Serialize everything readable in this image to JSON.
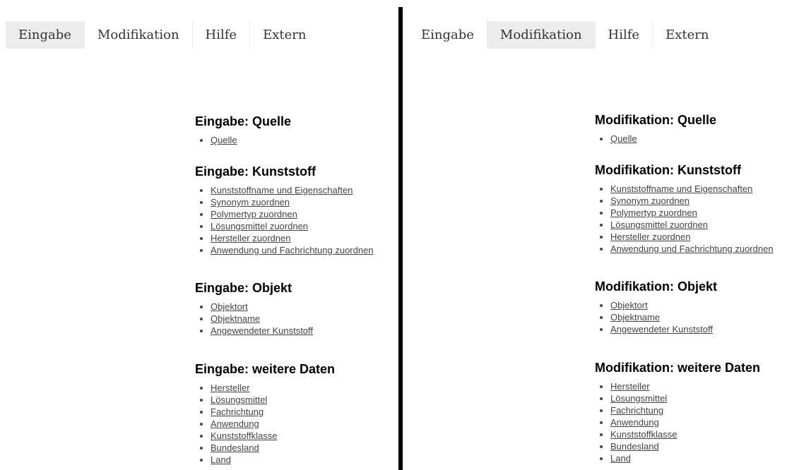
{
  "left": {
    "tabs": [
      "Eingabe",
      "Modifikation",
      "Hilfe",
      "Extern"
    ],
    "active_tab": 0,
    "sections": [
      {
        "title": "Eingabe: Quelle",
        "links": [
          "Quelle"
        ]
      },
      {
        "title": "Eingabe: Kunststoff",
        "links": [
          "Kunststoffname und Eigenschaften",
          "Synonym zuordnen",
          "Polymertyp zuordnen",
          "Lösungsmittel zuordnen",
          "Hersteller zuordnen",
          "Anwendung und Fachrichtung zuordnen"
        ]
      },
      {
        "title": "Eingabe: Objekt",
        "links": [
          "Objektort",
          "Objektname",
          "Angewendeter Kunststoff"
        ]
      },
      {
        "title": "Eingabe: weitere Daten",
        "links": [
          "Hersteller",
          "Lösungsmittel",
          "Fachrichtung",
          "Anwendung",
          "Kunststoffklasse",
          "Bundesland",
          "Land"
        ]
      }
    ]
  },
  "right": {
    "tabs": [
      "Eingabe",
      "Modifikation",
      "Hilfe",
      "Extern"
    ],
    "active_tab": 1,
    "sections": [
      {
        "title": "Modifikation: Quelle",
        "links": [
          "Quelle"
        ]
      },
      {
        "title": "Modifikation: Kunststoff",
        "links": [
          "Kunststoffname und Eigenschaften",
          "Synonym zuordnen",
          "Polymertyp zuordnen",
          "Lösungsmittel zuordnen",
          "Hersteller zuordnen",
          "Anwendung und Fachrichtung zuordnen"
        ]
      },
      {
        "title": "Modifikation: Objekt",
        "links": [
          "Objektort",
          "Objektname",
          "Angewendeter Kunststoff"
        ]
      },
      {
        "title": "Modifikation: weitere Daten",
        "links": [
          "Hersteller",
          "Lösungsmittel",
          "Fachrichtung",
          "Anwendung",
          "Kunststoffklasse",
          "Bundesland",
          "Land"
        ]
      }
    ]
  },
  "colors": {
    "tab_active_bg": "#ececec",
    "divider": "#000000",
    "link": "#444444"
  }
}
